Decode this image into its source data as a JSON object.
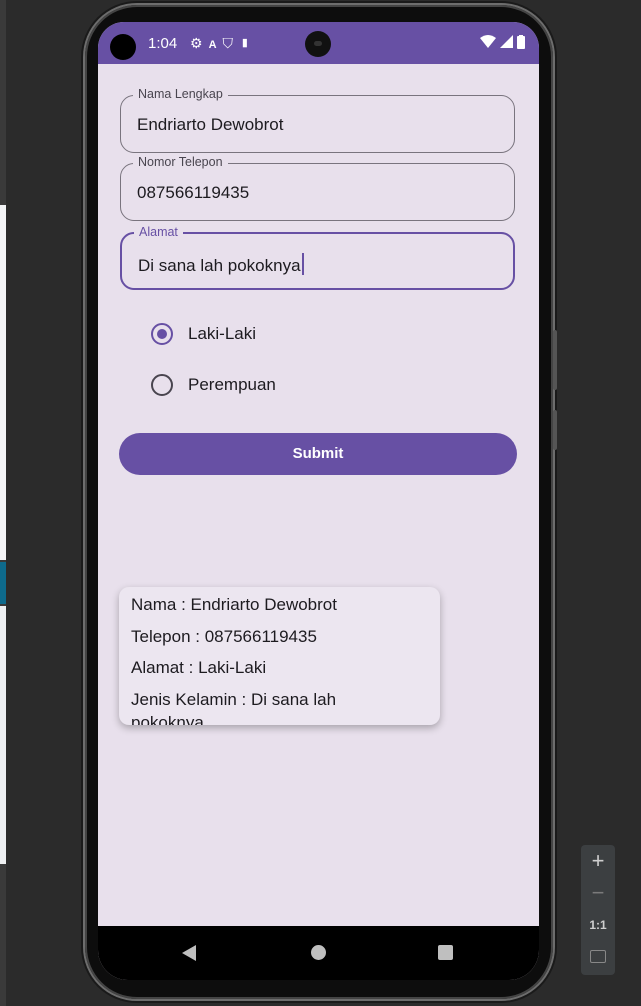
{
  "status_bar": {
    "time": "1:04",
    "left_icons": [
      "gear-icon",
      "a-icon",
      "shield-icon",
      "sim-card-icon"
    ],
    "right_icons": [
      "wifi-icon",
      "signal-icon",
      "battery-icon"
    ]
  },
  "form": {
    "nama": {
      "label": "Nama Lengkap",
      "value": "Endriarto Dewobrot"
    },
    "telepon": {
      "label": "Nomor Telepon",
      "value": "087566119435"
    },
    "alamat": {
      "label": "Alamat",
      "value": "Di sana lah pokoknya"
    },
    "gender_options": [
      {
        "label": "Laki-Laki",
        "selected": true
      },
      {
        "label": "Perempuan",
        "selected": false
      }
    ],
    "submit_label": "Submit"
  },
  "result": {
    "lines": [
      "Nama : Endriarto Dewobrot",
      "Telepon : 087566119435",
      "Alamat : Laki-Laki",
      "Jenis Kelamin : Di sana lah",
      "pokoknya"
    ]
  },
  "emulator_controls": {
    "zoom_in": "+",
    "zoom_out": "−",
    "actual_size": "1:1"
  },
  "colors": {
    "accent": "#6750a4",
    "surface": "#e8e0ec",
    "card": "#ece6f0"
  }
}
